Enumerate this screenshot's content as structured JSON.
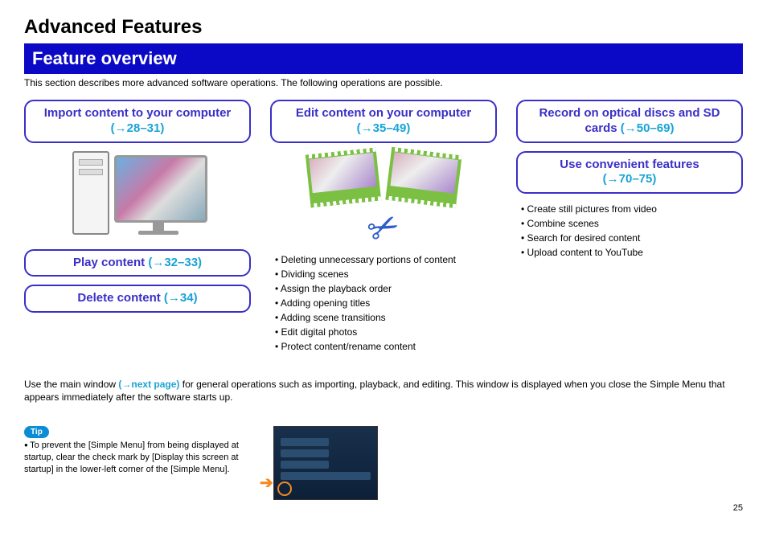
{
  "header": {
    "title": "Advanced Features"
  },
  "banner": {
    "title": "Feature overview"
  },
  "intro": "This section describes more advanced software operations. The following operations are possible.",
  "col1": {
    "import": {
      "text": "Import content to your computer ",
      "ref": "(→28–31)"
    },
    "play": {
      "text": "Play content ",
      "ref": "(→32–33)"
    },
    "delete": {
      "text": "Delete content ",
      "ref": "(→34)"
    }
  },
  "col2": {
    "edit": {
      "text": "Edit content on your computer ",
      "ref": "(→35–49)"
    },
    "bullets": [
      "Deleting unnecessary portions of content",
      "Dividing scenes",
      "Assign the playback order",
      "Adding opening titles",
      "Adding scene transitions",
      "Edit digital photos",
      "Protect content/rename content"
    ]
  },
  "col3": {
    "record": {
      "text": "Record on optical discs and SD cards ",
      "ref": "(→50–69)"
    },
    "conv": {
      "text": "Use convenient features",
      "ref": "(→70–75)"
    },
    "bullets": [
      "Create still pictures from video",
      "Combine scenes",
      "Search for desired content",
      "Upload content to YouTube"
    ]
  },
  "body": {
    "p1a": "Use the main window ",
    "p1link": "(→next page)",
    "p1b": " for general operations such as importing, playback, and editing. This window is displayed when you close the Simple Menu that appears immediately after the software starts up."
  },
  "tip": {
    "badge": "Tip",
    "text": "To prevent the [Simple Menu] from being displayed at startup, clear the check mark by [Display this screen at startup] in the lower-left corner of the [Simple Menu]."
  },
  "page": "25"
}
